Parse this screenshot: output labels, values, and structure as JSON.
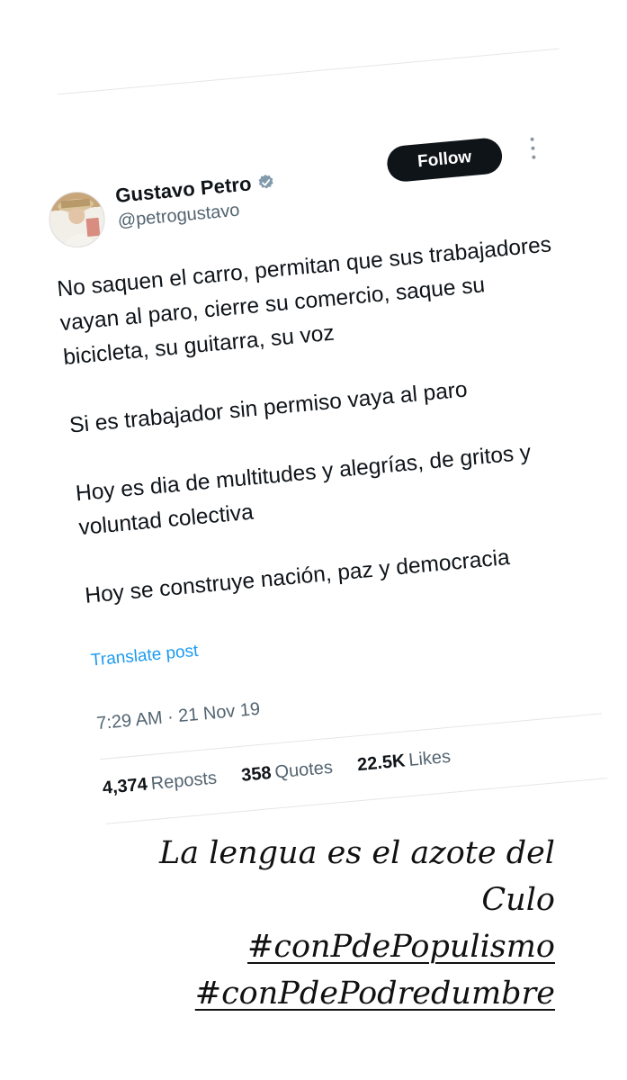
{
  "tweet": {
    "author_name": "Gustavo Petro",
    "handle": "@petrogustavo",
    "follow_label": "Follow",
    "paragraphs": [
      "No saquen el carro, permitan que sus trabajadores vayan al paro, cierre su comercio, saque su bicicleta, su guitarra, su voz",
      "Si es trabajador sin permiso vaya al paro",
      "Hoy es dia de multitudes y alegrías, de gritos y voluntad colectiva",
      "Hoy se construye nación, paz y democracia"
    ],
    "translate_label": "Translate post",
    "timestamp": "7:29 AM · 21 Nov 19",
    "stats": {
      "reposts_count": "4,374",
      "reposts_label": "Reposts",
      "quotes_count": "358",
      "quotes_label": "Quotes",
      "likes_count": "22.5K",
      "likes_label": "Likes"
    },
    "accent_color": "#1d9bf0",
    "verified_icon": "verified-badge-icon",
    "more_icon": "more-options-icon"
  },
  "caption": {
    "line1": "La lengua es el azote del",
    "line2": "Culo",
    "hashtag1": "#conPdePopulismo",
    "hashtag2": "#conPdePodredumbre"
  }
}
